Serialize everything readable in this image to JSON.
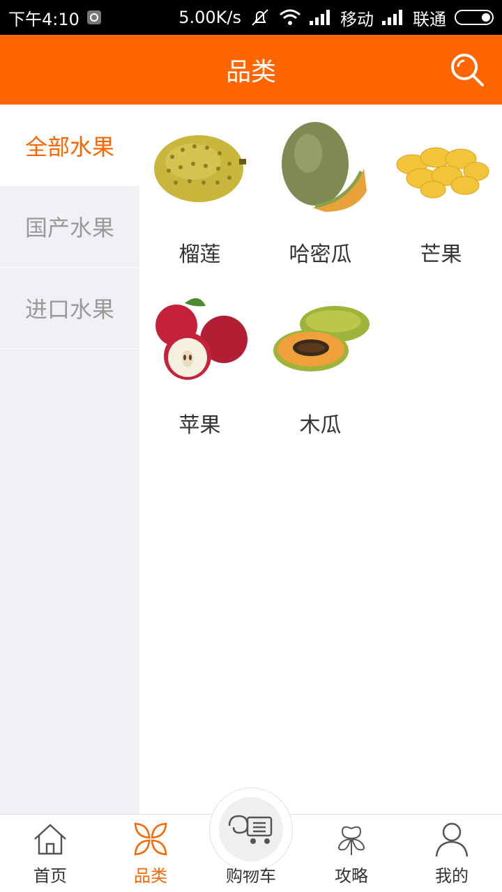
{
  "statusbar": {
    "time": "下午4:10",
    "speed": "5.00K/s",
    "carrier1": "移动",
    "carrier2": "联通"
  },
  "appbar": {
    "title": "品类",
    "search_icon": "search-icon"
  },
  "sidebar": {
    "items": [
      {
        "label": "全部水果",
        "active": true
      },
      {
        "label": "国产水果",
        "active": false
      },
      {
        "label": "进口水果",
        "active": false
      }
    ]
  },
  "products": [
    {
      "name": "榴莲",
      "icon": "durian-image"
    },
    {
      "name": "哈密瓜",
      "icon": "hami-melon-image"
    },
    {
      "name": "芒果",
      "icon": "mango-image"
    },
    {
      "name": "苹果",
      "icon": "apple-image"
    },
    {
      "name": "木瓜",
      "icon": "papaya-image"
    }
  ],
  "tabbar": {
    "items": [
      {
        "label": "首页",
        "icon": "home-icon",
        "active": false
      },
      {
        "label": "品类",
        "icon": "category-icon",
        "active": true
      },
      {
        "label": "购物车",
        "icon": "cart-icon",
        "active": false
      },
      {
        "label": "攻略",
        "icon": "clover-icon",
        "active": false
      },
      {
        "label": "我的",
        "icon": "user-icon",
        "active": false
      }
    ]
  },
  "colors": {
    "accent": "#ff6600",
    "sidebar_bg": "#f0f1f5",
    "inactive_text": "#9a9a9a"
  }
}
